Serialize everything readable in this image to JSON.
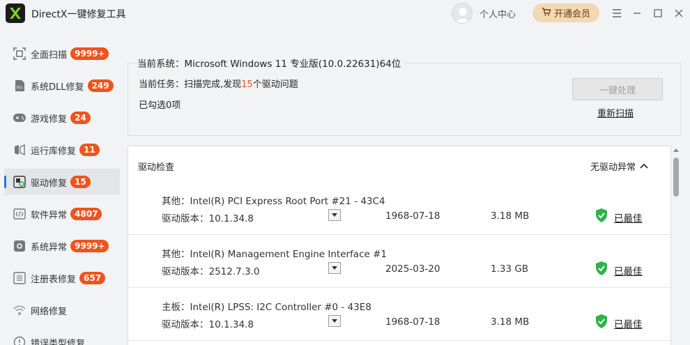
{
  "app": {
    "title": "DirectX一键修复工具"
  },
  "header": {
    "user_center": "个人中心",
    "vip_label": "开通会员"
  },
  "sidebar": {
    "items": [
      {
        "label": "全面扫描",
        "badge": "9999+",
        "icon": "scan-icon"
      },
      {
        "label": "系统DLL修复",
        "badge": "249",
        "icon": "dll-icon"
      },
      {
        "label": "游戏修复",
        "badge": "24",
        "icon": "gamepad-icon"
      },
      {
        "label": "运行库修复",
        "badge": "11",
        "icon": "runtime-icon"
      },
      {
        "label": "驱动修复",
        "badge": "15",
        "icon": "driver-icon",
        "active": true
      },
      {
        "label": "软件异常",
        "badge": "4807",
        "icon": "code-icon"
      },
      {
        "label": "系统异常",
        "badge": "9999+",
        "icon": "gear-icon"
      },
      {
        "label": "注册表修复",
        "badge": "657",
        "icon": "list-icon"
      },
      {
        "label": "网络修复",
        "badge": "",
        "icon": "wifi-icon"
      },
      {
        "label": "错误类型修复",
        "badge": "",
        "icon": "error-icon"
      }
    ]
  },
  "info": {
    "system_label": "当前系统：",
    "system_value": "Microsoft Windows 11 专业版(10.0.22631)64位",
    "task_label": "当前任务：",
    "task_prefix": "扫描完成,发现",
    "task_count": "15",
    "task_suffix": "个驱动问题",
    "selected": "已勾选0项",
    "process_button": "一键处理",
    "rescan": "重新扫描"
  },
  "driver_list": {
    "header": "驱动检查",
    "status": "无驱动异常",
    "rows": [
      {
        "name": "其他：Intel(R) PCI Express Root Port #21 - 43C4",
        "version": "驱动版本：10.1.34.8",
        "date": "1968-07-18",
        "size": "3.18 MB",
        "state": "已最佳"
      },
      {
        "name": "其他：Intel(R) Management Engine Interface #1",
        "version": "驱动版本：2512.7.3.0",
        "date": "2025-03-20",
        "size": "1.33 GB",
        "state": "已最佳"
      },
      {
        "name": "主板：Intel(R) LPSS: I2C Controller #0 - 43E8",
        "version": "驱动版本：10.1.34.8",
        "date": "1968-07-18",
        "size": "3.18 MB",
        "state": "已最佳"
      }
    ]
  },
  "colors": {
    "accent": "#f0531c",
    "active_indicator": "#2f6fe4",
    "vip_bg": "#f2d8b3",
    "shield_green": "#2fb24a"
  }
}
